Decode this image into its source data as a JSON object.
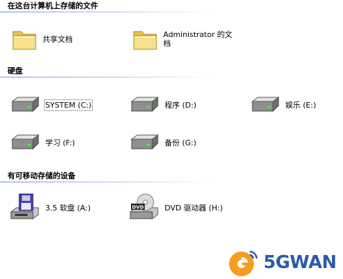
{
  "sections": {
    "files": {
      "title": "在这台计算机上存储的文件"
    },
    "drives": {
      "title": "硬盘"
    },
    "removable": {
      "title": "有可移动存储的设备"
    }
  },
  "folders": [
    {
      "label": "共享文档",
      "icon": "folder-icon"
    },
    {
      "label": "Administrator 的文档",
      "icon": "folder-icon"
    }
  ],
  "hard_drives": [
    {
      "label": "SYSTEM (C:)",
      "icon": "hard-drive-icon",
      "selected": true
    },
    {
      "label": "程序 (D:)",
      "icon": "hard-drive-icon"
    },
    {
      "label": "娱乐 (E:)",
      "icon": "hard-drive-icon"
    },
    {
      "label": "学习 (F:)",
      "icon": "hard-drive-icon"
    },
    {
      "label": "备份 (G:)",
      "icon": "hard-drive-icon"
    }
  ],
  "removable_devices": [
    {
      "label": "3.5 软盘 (A:)",
      "icon": "floppy-drive-icon"
    },
    {
      "label": "DVD 驱动器 (H:)",
      "icon": "dvd-drive-icon"
    }
  ],
  "watermark": {
    "text": "5GWAN"
  },
  "colors": {
    "header_rule": "#6b8fc8",
    "folder": "#f5d76e",
    "drive": "#9a9a9a",
    "watermark": "#2c5aa8"
  }
}
